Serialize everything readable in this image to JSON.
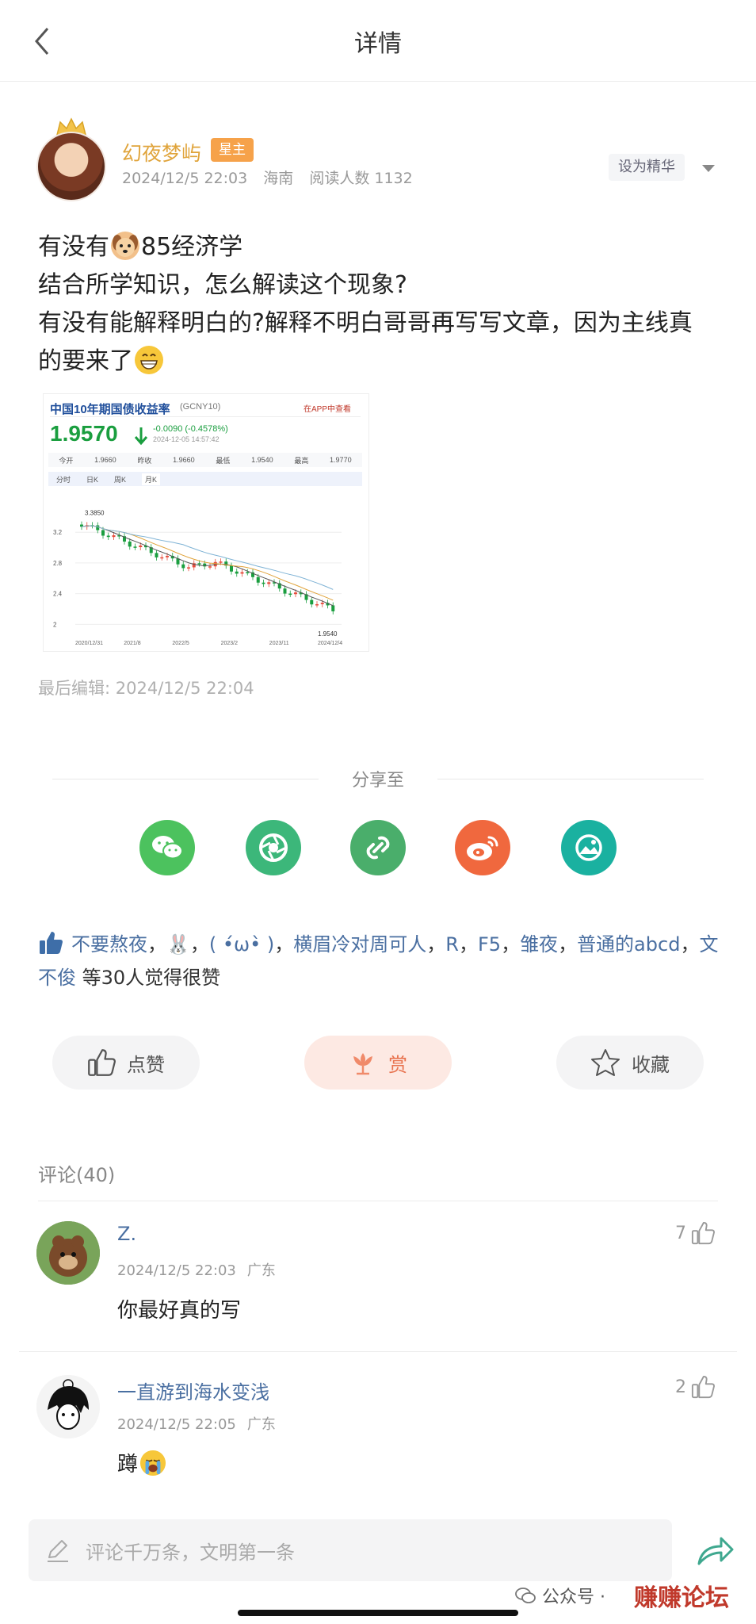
{
  "header": {
    "title": "详情",
    "back_icon": "chevron-left-icon"
  },
  "author": {
    "name": "幻夜梦屿",
    "badge": "星主",
    "time": "2024/12/5 22:03",
    "location": "海南",
    "readers": "阅读人数 1132",
    "action": "设为精华"
  },
  "post": {
    "line1_a": "有没有",
    "line1_b": "85经济学",
    "line2": "结合所学知识，怎么解读这个现象?",
    "line3": "有没有能解释明白的?解释不明白哥哥再写写文章，因为主线真",
    "line4": "的要来了",
    "last_edit": "最后编辑: 2024/12/5 22:04"
  },
  "chart_image": {
    "title": "中国10年期国债收益率",
    "code": "(GCNY10)",
    "app_link": "在APP中查看",
    "price": "1.9570",
    "change": "-0.0090 (-0.4578%)",
    "timestamp": "2024-12-05 14:57:42",
    "quotes": [
      "今开",
      "1.9660",
      "昨收",
      "1.9660",
      "最低",
      "1.9540",
      "最高",
      "1.9770"
    ],
    "tabs": [
      "分时",
      "日K",
      "周K",
      "月K"
    ],
    "peak_label": "3.3850",
    "low_label": "1.9540",
    "y_ticks": [
      "3.2",
      "2.8",
      "2.4",
      "2"
    ],
    "x_ticks": [
      "2020/12/31",
      "2021/8",
      "2022/5",
      "2023/2",
      "2023/11",
      "2024/12/4"
    ],
    "colors": {
      "up": "#e74c3c",
      "down": "#1a9e3f",
      "ma5": "#555555",
      "ma10": "#e0a33b",
      "ma20": "#7fb3d5"
    }
  },
  "share": {
    "label": "分享至",
    "items": [
      "wechat-icon",
      "moments-icon",
      "link-icon",
      "weibo-icon",
      "qzone-icon"
    ]
  },
  "likes": {
    "names": [
      "不要熬夜",
      "🐰",
      "( •́ω•̀ )",
      "横眉冷对周可人",
      "R",
      "F5",
      "雏夜",
      "普通的abcd",
      "文不俊"
    ],
    "suffix": "等30人觉得很赞"
  },
  "actions": {
    "like": "点赞",
    "reward": "赏",
    "collect": "收藏"
  },
  "comments": {
    "title": "评论(40)",
    "items": [
      {
        "name": "Z.",
        "time": "2024/12/5 22:03",
        "location": "广东",
        "text": "你最好真的写",
        "likes": "7"
      },
      {
        "name": "一直游到海水变浅",
        "time": "2024/12/5 22:05",
        "location": "广东",
        "text": "蹲",
        "likes": "2"
      }
    ]
  },
  "bottom": {
    "placeholder": "评论千万条，文明第一条",
    "watermark": "公众号 ·",
    "watermark_brand": "赚赚论坛"
  }
}
